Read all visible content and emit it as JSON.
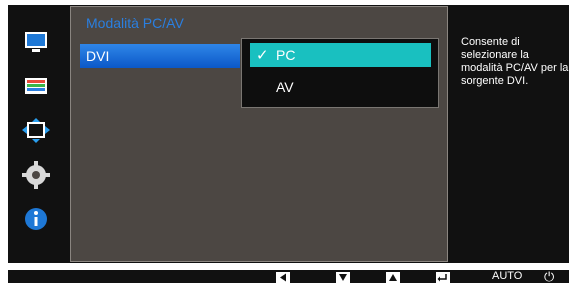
{
  "menu": {
    "title": "Modalità PC/AV",
    "row_label": "DVI"
  },
  "dropdown": {
    "options": [
      {
        "label": "PC",
        "selected": true
      },
      {
        "label": "AV",
        "selected": false
      }
    ]
  },
  "help_text": "Consente di selezionare la modalità PC/AV per la sorgente DVI.",
  "bottom_bar": {
    "auto_label": "AUTO"
  },
  "colors": {
    "accent_blue": "#2a7fe0",
    "selected_option": "#19c0c0"
  },
  "icons": [
    "monitor-icon",
    "color-bars-icon",
    "resize-arrows-icon",
    "gear-icon",
    "info-icon",
    "left-arrow-icon",
    "down-arrow-icon",
    "up-arrow-icon",
    "enter-icon",
    "power-icon"
  ]
}
